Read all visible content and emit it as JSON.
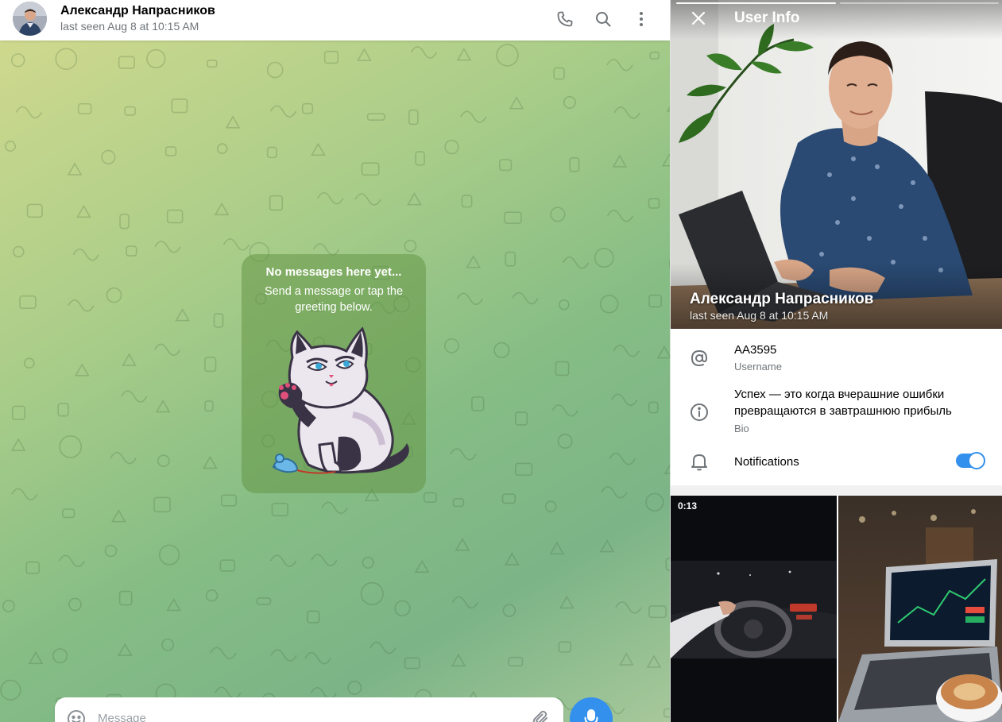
{
  "chat": {
    "header": {
      "name": "Александр Напрасников",
      "status": "last seen Aug 8 at 10:15 AM",
      "actions": [
        "phone-icon",
        "search-icon",
        "more-vertical-icon"
      ]
    },
    "empty_state": {
      "title": "No messages here yet...",
      "subtitle": "Send a message or tap the greeting below.",
      "sticker": "cat-waving-sticker"
    },
    "composer": {
      "placeholder": "Message",
      "value": "",
      "icons": [
        "emoji-icon",
        "attach-icon",
        "microphone-icon"
      ]
    }
  },
  "info_panel": {
    "title": "User Info",
    "close_icon": "close-icon",
    "photo_count": 2,
    "active_photo": 1,
    "name": "Александр Напрасников",
    "status": "last seen Aug 8 at 10:15 AM",
    "username": {
      "value": "AA3595",
      "label": "Username"
    },
    "bio": {
      "value": "Успех — это когда вчерашние ошибки превращаются в завтрашнюю прибыль",
      "label": "Bio"
    },
    "notifications": {
      "label": "Notifications",
      "enabled": true
    },
    "media": [
      {
        "type": "video",
        "duration": "0:13"
      },
      {
        "type": "photo"
      }
    ]
  },
  "colors": {
    "accent": "#3390ec",
    "secondary_text": "#707579",
    "card": "#6a9a46"
  }
}
